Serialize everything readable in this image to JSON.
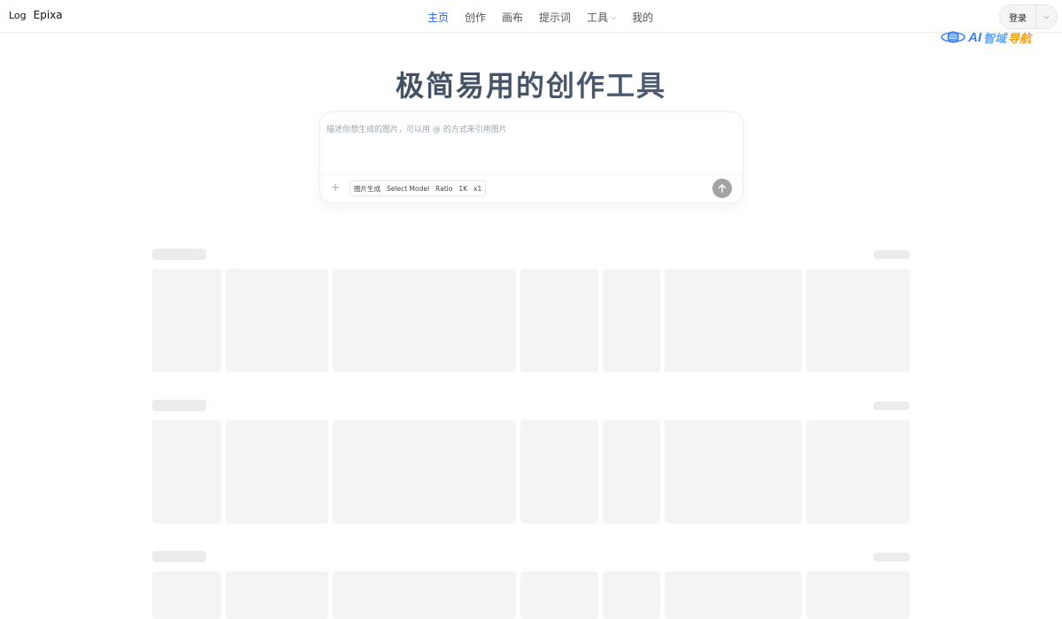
{
  "header": {
    "logo_text": "Log",
    "brand": "Epixa",
    "nav": [
      {
        "label": "主页",
        "active": true
      },
      {
        "label": "创作"
      },
      {
        "label": "画布"
      },
      {
        "label": "提示词"
      },
      {
        "label": "工具",
        "has_dropdown": true
      },
      {
        "label": "我的"
      }
    ],
    "login_label": "登录"
  },
  "watermark": {
    "part1": "AI",
    "part2": "智域",
    "part3": "导航"
  },
  "hero": {
    "title": "极简易用的创作工具"
  },
  "prompt": {
    "placeholder": "描述你想生成的图片，可以用 @ 的方式来引用图片",
    "value": "",
    "mode": "图片生成",
    "model": "Select Model",
    "ratio": "Ratio",
    "resolution": "1K",
    "count": "x1"
  },
  "colors": {
    "accent": "#2563eb",
    "send_button": "#a3a3a3",
    "skeleton": "#f4f4f4"
  },
  "gallery": {
    "loading": true,
    "rows": 3
  }
}
